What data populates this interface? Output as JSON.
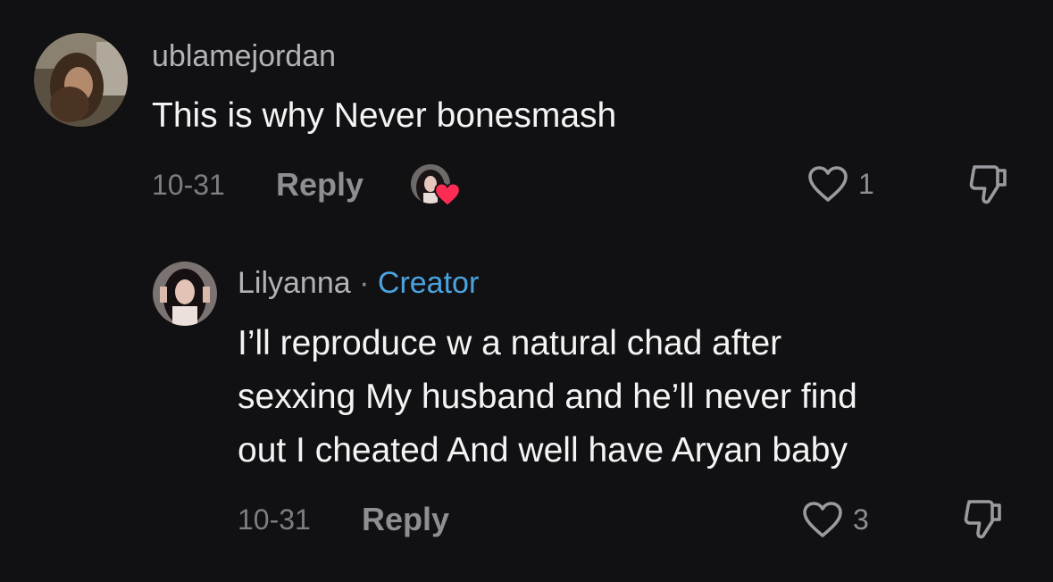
{
  "comments": [
    {
      "username": "ublamejordan",
      "text": "This is why Never bonesmash",
      "date": "10-31",
      "reply_label": "Reply",
      "likes": "1",
      "icons": {
        "avatar": "user-avatar",
        "creator_liked": "creator-liked-heart-icon",
        "like": "heart-outline-icon",
        "dislike": "thumbs-down-icon"
      },
      "creator_liked_heart_color": "#fe2c55"
    },
    {
      "username": "Lilyanna",
      "separator": "·",
      "badge": "Creator",
      "text_lines": [
        "I’ll reproduce w a natural chad after",
        "sexxing My husband and he’ll never find",
        "out I cheated And well have Aryan baby"
      ],
      "date": "10-31",
      "reply_label": "Reply",
      "likes": "3",
      "icons": {
        "avatar": "creator-avatar",
        "like": "heart-outline-icon",
        "dislike": "thumbs-down-icon"
      }
    }
  ],
  "colors": {
    "background": "#111113",
    "creator_badge": "#4aa3df",
    "secondary_text": "#8e8e93"
  }
}
